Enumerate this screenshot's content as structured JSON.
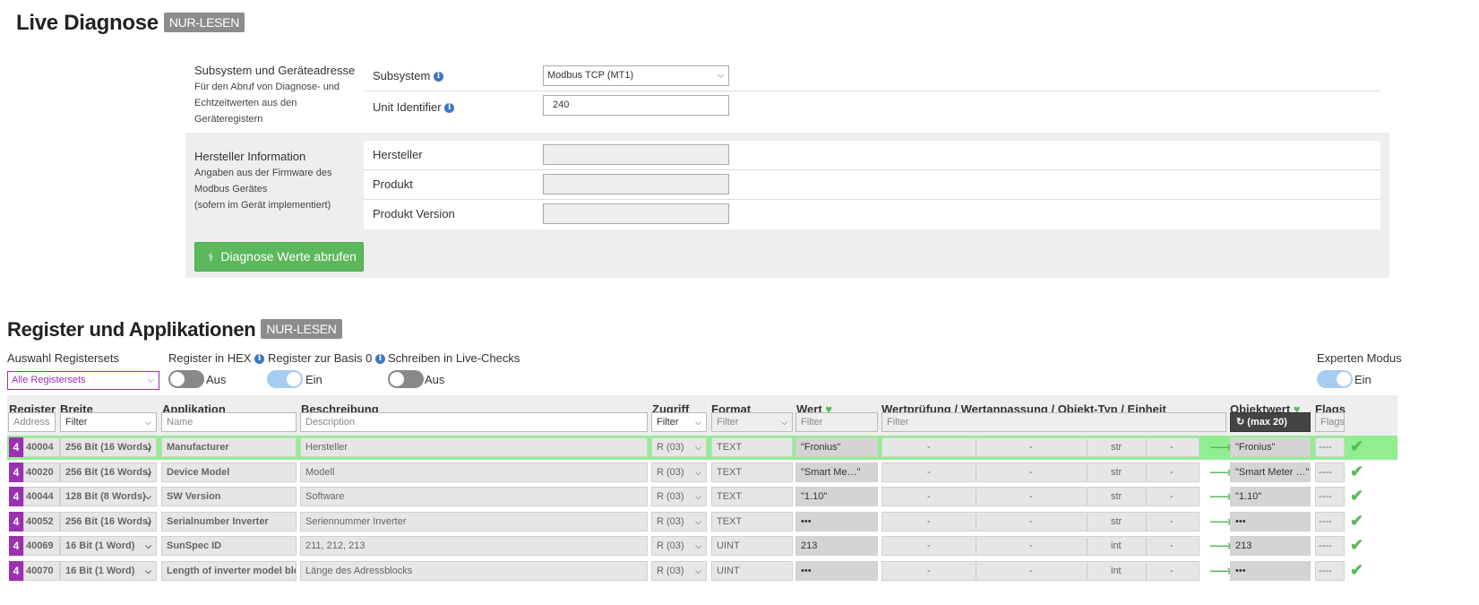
{
  "live": {
    "title": "Live Diagnose",
    "badge": "NUR-LESEN",
    "subsystem_section": {
      "title": "Subsystem und Geräteadresse",
      "desc": [
        "Für den Abruf von Diagnose- und",
        "Echtzeitwerten aus den",
        "Geräteregistern"
      ],
      "subsystem_label": "Subsystem",
      "subsystem_value": "Modbus TCP (MT1)",
      "unit_label": "Unit Identifier",
      "unit_value": "240"
    },
    "manufacturer_section": {
      "title": "Hersteller Information",
      "desc": [
        "Angaben aus der Firmware des",
        "Modbus Gerätes",
        "(sofern im Gerät implementiert)"
      ],
      "hersteller_label": "Hersteller",
      "produkt_label": "Produkt",
      "version_label": "Produkt Version"
    },
    "button_label": "Diagnose Werte abrufen"
  },
  "register": {
    "title": "Register und Applikationen",
    "badge": "NUR-LESEN",
    "registersets_label": "Auswahl Registersets",
    "registersets_value": "Alle Registersets",
    "hex_label": "Register in HEX",
    "hex_state": "Aus",
    "basis_label": "Register zur Basis 0",
    "basis_state": "Ein",
    "write_label": "Schreiben in Live-Checks",
    "write_state": "Aus",
    "expert_label": "Experten Modus",
    "expert_state": "Ein"
  },
  "table": {
    "headers": {
      "register": "Register",
      "breite": "Breite",
      "applikation": "Applikation",
      "beschreibung": "Beschreibung",
      "zugriff": "Zugriff",
      "format": "Format",
      "wert": "Wert",
      "pruefung": "Wertprüfung / Wertanpassung / Objekt-Typ / Einheit",
      "objektwert": "Objektwert",
      "flags": "Flags"
    },
    "filters": {
      "address": "Address",
      "breite": "Filter",
      "name": "Name",
      "description": "Description",
      "zugriff": "Filter",
      "format": "Filter",
      "wert": "Filter",
      "pruefung": "Filter",
      "objektwert_btn": "(max 20)",
      "flags": "Flags"
    },
    "rows": [
      {
        "set": "4",
        "address": "40004",
        "width": "256 Bit (16 Words)",
        "app": "Manufacturer",
        "desc": "Hersteller",
        "access": "R (03)",
        "format": "TEXT",
        "value": "\"Fronius\"",
        "c1": "-",
        "c2": "-",
        "type": "str",
        "unit": "-",
        "obj": "\"Fronius\"",
        "flags": "----"
      },
      {
        "set": "4",
        "address": "40020",
        "width": "256 Bit (16 Words)",
        "app": "Device Model",
        "desc": "Modell",
        "access": "R (03)",
        "format": "TEXT",
        "value": "\"Smart Me…\"",
        "c1": "-",
        "c2": "-",
        "type": "str",
        "unit": "-",
        "obj": "\"Smart Meter …\"",
        "flags": "----"
      },
      {
        "set": "4",
        "address": "40044",
        "width": "128 Bit (8 Words)",
        "app": "SW Version",
        "desc": "Software",
        "access": "R (03)",
        "format": "TEXT",
        "value": "\"1.10\"",
        "c1": "-",
        "c2": "-",
        "type": "str",
        "unit": "-",
        "obj": "\"1.10\"",
        "flags": "----"
      },
      {
        "set": "4",
        "address": "40052",
        "width": "256 Bit (16 Words)",
        "app": "Serialnumber Inverter",
        "desc": "Seriennummer Inverter",
        "access": "R (03)",
        "format": "TEXT",
        "value": "•••",
        "c1": "-",
        "c2": "-",
        "type": "str",
        "unit": "-",
        "obj": "•••",
        "flags": "----"
      },
      {
        "set": "4",
        "address": "40069",
        "width": "16 Bit (1 Word)",
        "app": "SunSpec ID",
        "desc": "211, 212, 213",
        "access": "R (03)",
        "format": "UINT",
        "value": "213",
        "c1": "-",
        "c2": "-",
        "type": "int",
        "unit": "-",
        "obj": "213",
        "flags": "----"
      },
      {
        "set": "4",
        "address": "40070",
        "width": "16 Bit (1 Word)",
        "app": "Length of inverter model block",
        "desc": "Länge des Adressblocks",
        "access": "R (03)",
        "format": "UINT",
        "value": "•••",
        "c1": "-",
        "c2": "-",
        "type": "int",
        "unit": "-",
        "obj": "•••",
        "flags": "----"
      }
    ]
  },
  "colors": {
    "accent_green": "#5cb85c",
    "purple": "#9b30b0",
    "highlight": "#90ee90",
    "toggle_on": "#a6cdf0"
  }
}
